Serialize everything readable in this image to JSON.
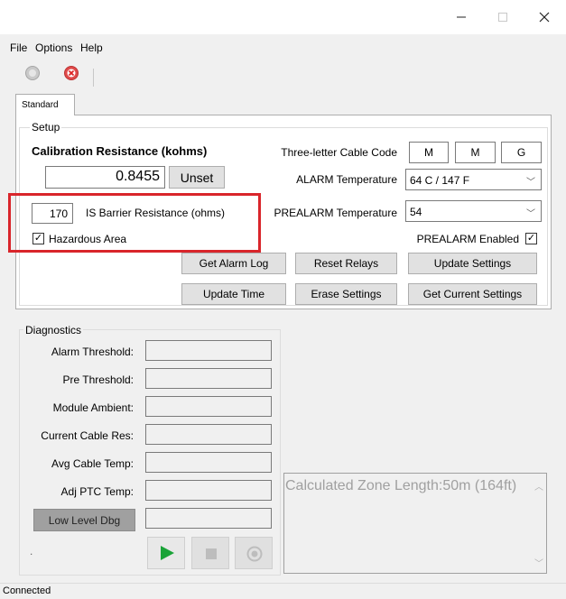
{
  "window": {
    "minimize_icon": "minimize-icon",
    "maximize_icon": "maximize-icon",
    "close_icon": "close-icon"
  },
  "menu": [
    "File",
    "Options",
    "Help"
  ],
  "toolbar": {
    "connect_icon": "gray-connect-icon",
    "disconnect_icon": "red-x-icon"
  },
  "tabs": {
    "active": "Standard"
  },
  "setup": {
    "group_label": "Setup",
    "calibration_label": "Calibration Resistance (kohms)",
    "calibration_value": "0.8455",
    "unset_label": "Unset",
    "barrier_value": "170",
    "barrier_label": "IS Barrier Resistance (ohms)",
    "hazardous_label": "Hazardous Area",
    "hazardous_checked": "✓",
    "cable_code_label": "Three-letter Cable Code",
    "cable_code": [
      "M",
      "M",
      "G"
    ],
    "alarm_temp_label": "ALARM Temperature",
    "alarm_temp_value": "64 C / 147 F",
    "prealarm_temp_label": "PREALARM Temperature",
    "prealarm_temp_value": "54",
    "prealarm_enabled_label": "PREALARM Enabled",
    "prealarm_enabled_checked": "✓",
    "buttons": {
      "get_alarm_log": "Get Alarm Log",
      "reset_relays": "Reset Relays",
      "update_settings": "Update Settings",
      "update_time": "Update Time",
      "erase_settings": "Erase Settings",
      "get_current_settings": "Get Current Settings"
    }
  },
  "diagnostics": {
    "group_label": "Diagnostics",
    "rows": [
      {
        "label": "Alarm Threshold:",
        "value": ""
      },
      {
        "label": "Pre Threshold:",
        "value": ""
      },
      {
        "label": "Module Ambient:",
        "value": ""
      },
      {
        "label": "Current Cable Res:",
        "value": ""
      },
      {
        "label": "Avg Cable Temp:",
        "value": ""
      },
      {
        "label": "Adj PTC Temp:",
        "value": ""
      }
    ],
    "low_level_label": "Low Level Dbg",
    "low_level_value": "",
    "dot_text": ".",
    "zone_text": "Calculated Zone Length:50m (164ft)",
    "colors": {
      "play": "#1aa338",
      "highlight_box": "#d9252b"
    }
  },
  "status": {
    "text": "Connected"
  }
}
